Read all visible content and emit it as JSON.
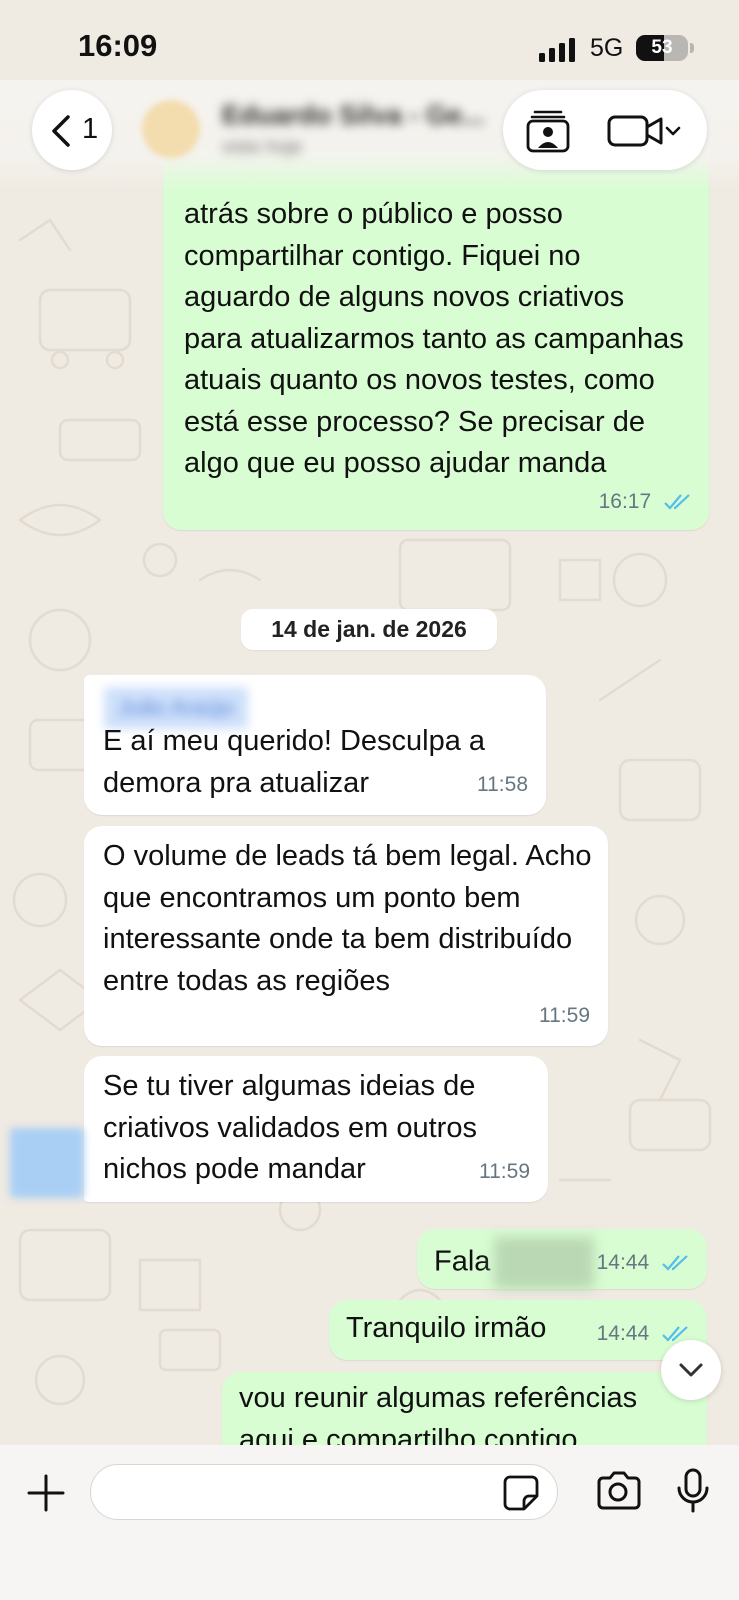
{
  "status_bar": {
    "time": "16:09",
    "network": "5G",
    "battery": "53",
    "battery_level": 0.53
  },
  "header": {
    "back_count": "1",
    "contact_name": "Eduardo Silva - Ge...",
    "contact_subtitle": "visto hoje"
  },
  "messages": [
    {
      "direction": "outgoing",
      "text": "atrás sobre o público e posso compartilhar contigo. Fiquei no aguardo de alguns novos criativos para atualizarmos tanto as campanhas atuais quanto os novos testes, como está esse processo? Se precisar de algo que eu posso ajudar manda",
      "time": "16:17",
      "status": "read"
    },
    {
      "type": "date",
      "text": "14 de jan. de 2026"
    },
    {
      "direction": "incoming",
      "sender": "João Araújo",
      "text": "E aí meu querido! Desculpa a demora pra atualizar",
      "time": "11:58"
    },
    {
      "direction": "incoming",
      "text": "O volume de leads tá bem legal. Acho que encontramos um ponto bem interessante onde ta bem distribuído entre todas as regiões",
      "time": "11:59"
    },
    {
      "direction": "incoming",
      "text": "Se tu tiver algumas ideias de criativos validados em outros nichos pode mandar",
      "time": "11:59"
    },
    {
      "direction": "outgoing",
      "text": "Fala",
      "time": "14:44",
      "status": "read"
    },
    {
      "direction": "outgoing",
      "text": "Tranquilo irmão",
      "time": "14:44",
      "status": "read"
    },
    {
      "direction": "outgoing",
      "text": "vou reunir algumas referências aqui e compartilho contigo",
      "time": "",
      "status": ""
    }
  ],
  "composer": {
    "placeholder": ""
  },
  "icons": {
    "back": "chevron-left-icon",
    "voice_call": "voice-call-icon",
    "video_call": "video-camera-icon",
    "plus": "plus-icon",
    "sticker": "sticker-icon",
    "camera": "camera-icon",
    "mic": "microphone-icon",
    "scroll": "chevron-down-icon"
  },
  "colors": {
    "outgoing_bubble": "#d9fdd3",
    "incoming_bubble": "#ffffff",
    "background": "#efeae2",
    "read_ticks": "#53bdeb"
  }
}
